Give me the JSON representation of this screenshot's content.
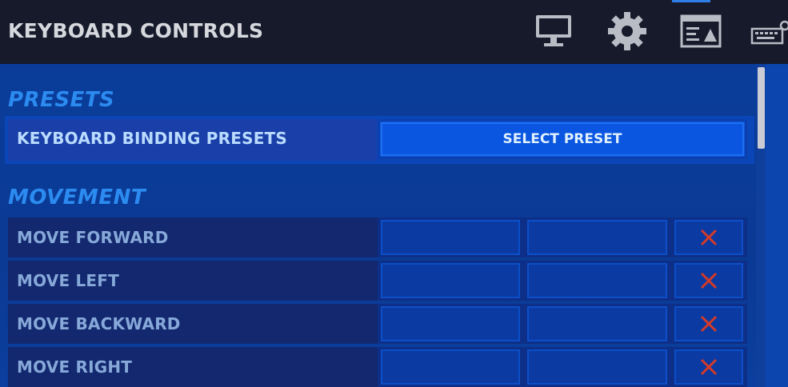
{
  "header": {
    "title": "KEYBOARD CONTROLS",
    "tabs": [
      {
        "icon": "monitor-icon"
      },
      {
        "icon": "gear-icon"
      },
      {
        "icon": "game-ui-icon"
      },
      {
        "icon": "keyboard-gamepad-icon",
        "active": true
      }
    ]
  },
  "sections": {
    "presets": {
      "title": "PRESETS",
      "row_label": "KEYBOARD BINDING PRESETS",
      "button_label": "SELECT PRESET"
    },
    "movement": {
      "title": "MOVEMENT",
      "rows": [
        {
          "label": "MOVE FORWARD"
        },
        {
          "label": "MOVE LEFT"
        },
        {
          "label": "MOVE BACKWARD"
        },
        {
          "label": "MOVE RIGHT"
        }
      ]
    }
  },
  "colors": {
    "accent": "#2c8bf0",
    "clear_icon": "#d23a2a",
    "header_bg": "#161a2a"
  }
}
